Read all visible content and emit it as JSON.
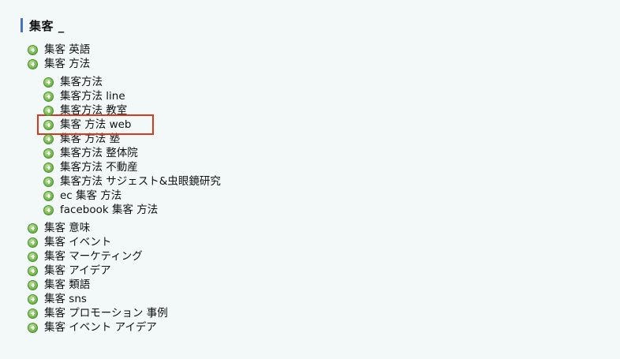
{
  "heading": {
    "title": "集客 _"
  },
  "tree": {
    "items": [
      {
        "label": "集客 英語"
      },
      {
        "label": "集客 方法",
        "children": [
          {
            "label": "集客方法"
          },
          {
            "label": "集客方法 line"
          },
          {
            "label": "集客方法 教室"
          },
          {
            "label": "集客 方法 web"
          },
          {
            "label": "集客 方法 塾"
          },
          {
            "label": "集客方法 整体院"
          },
          {
            "label": "集客方法 不動産"
          },
          {
            "label": "集客方法 サジェスト&虫眼鏡研究"
          },
          {
            "label": "ec 集客 方法"
          },
          {
            "label": "facebook 集客 方法"
          }
        ]
      },
      {
        "label": "集客 意味"
      },
      {
        "label": "集客 イベント"
      },
      {
        "label": "集客 マーケティング"
      },
      {
        "label": "集客 アイデア"
      },
      {
        "label": "集客 類語"
      },
      {
        "label": "集客 sns"
      },
      {
        "label": "集客 プロモーション 事例"
      },
      {
        "label": "集客 イベント アイデア"
      }
    ]
  },
  "icons": {
    "expand": "plus-circle-icon"
  },
  "colors": {
    "highlight": "#d9381e",
    "accent": "#4a6fc7",
    "icon_green": "#7cbf53"
  }
}
